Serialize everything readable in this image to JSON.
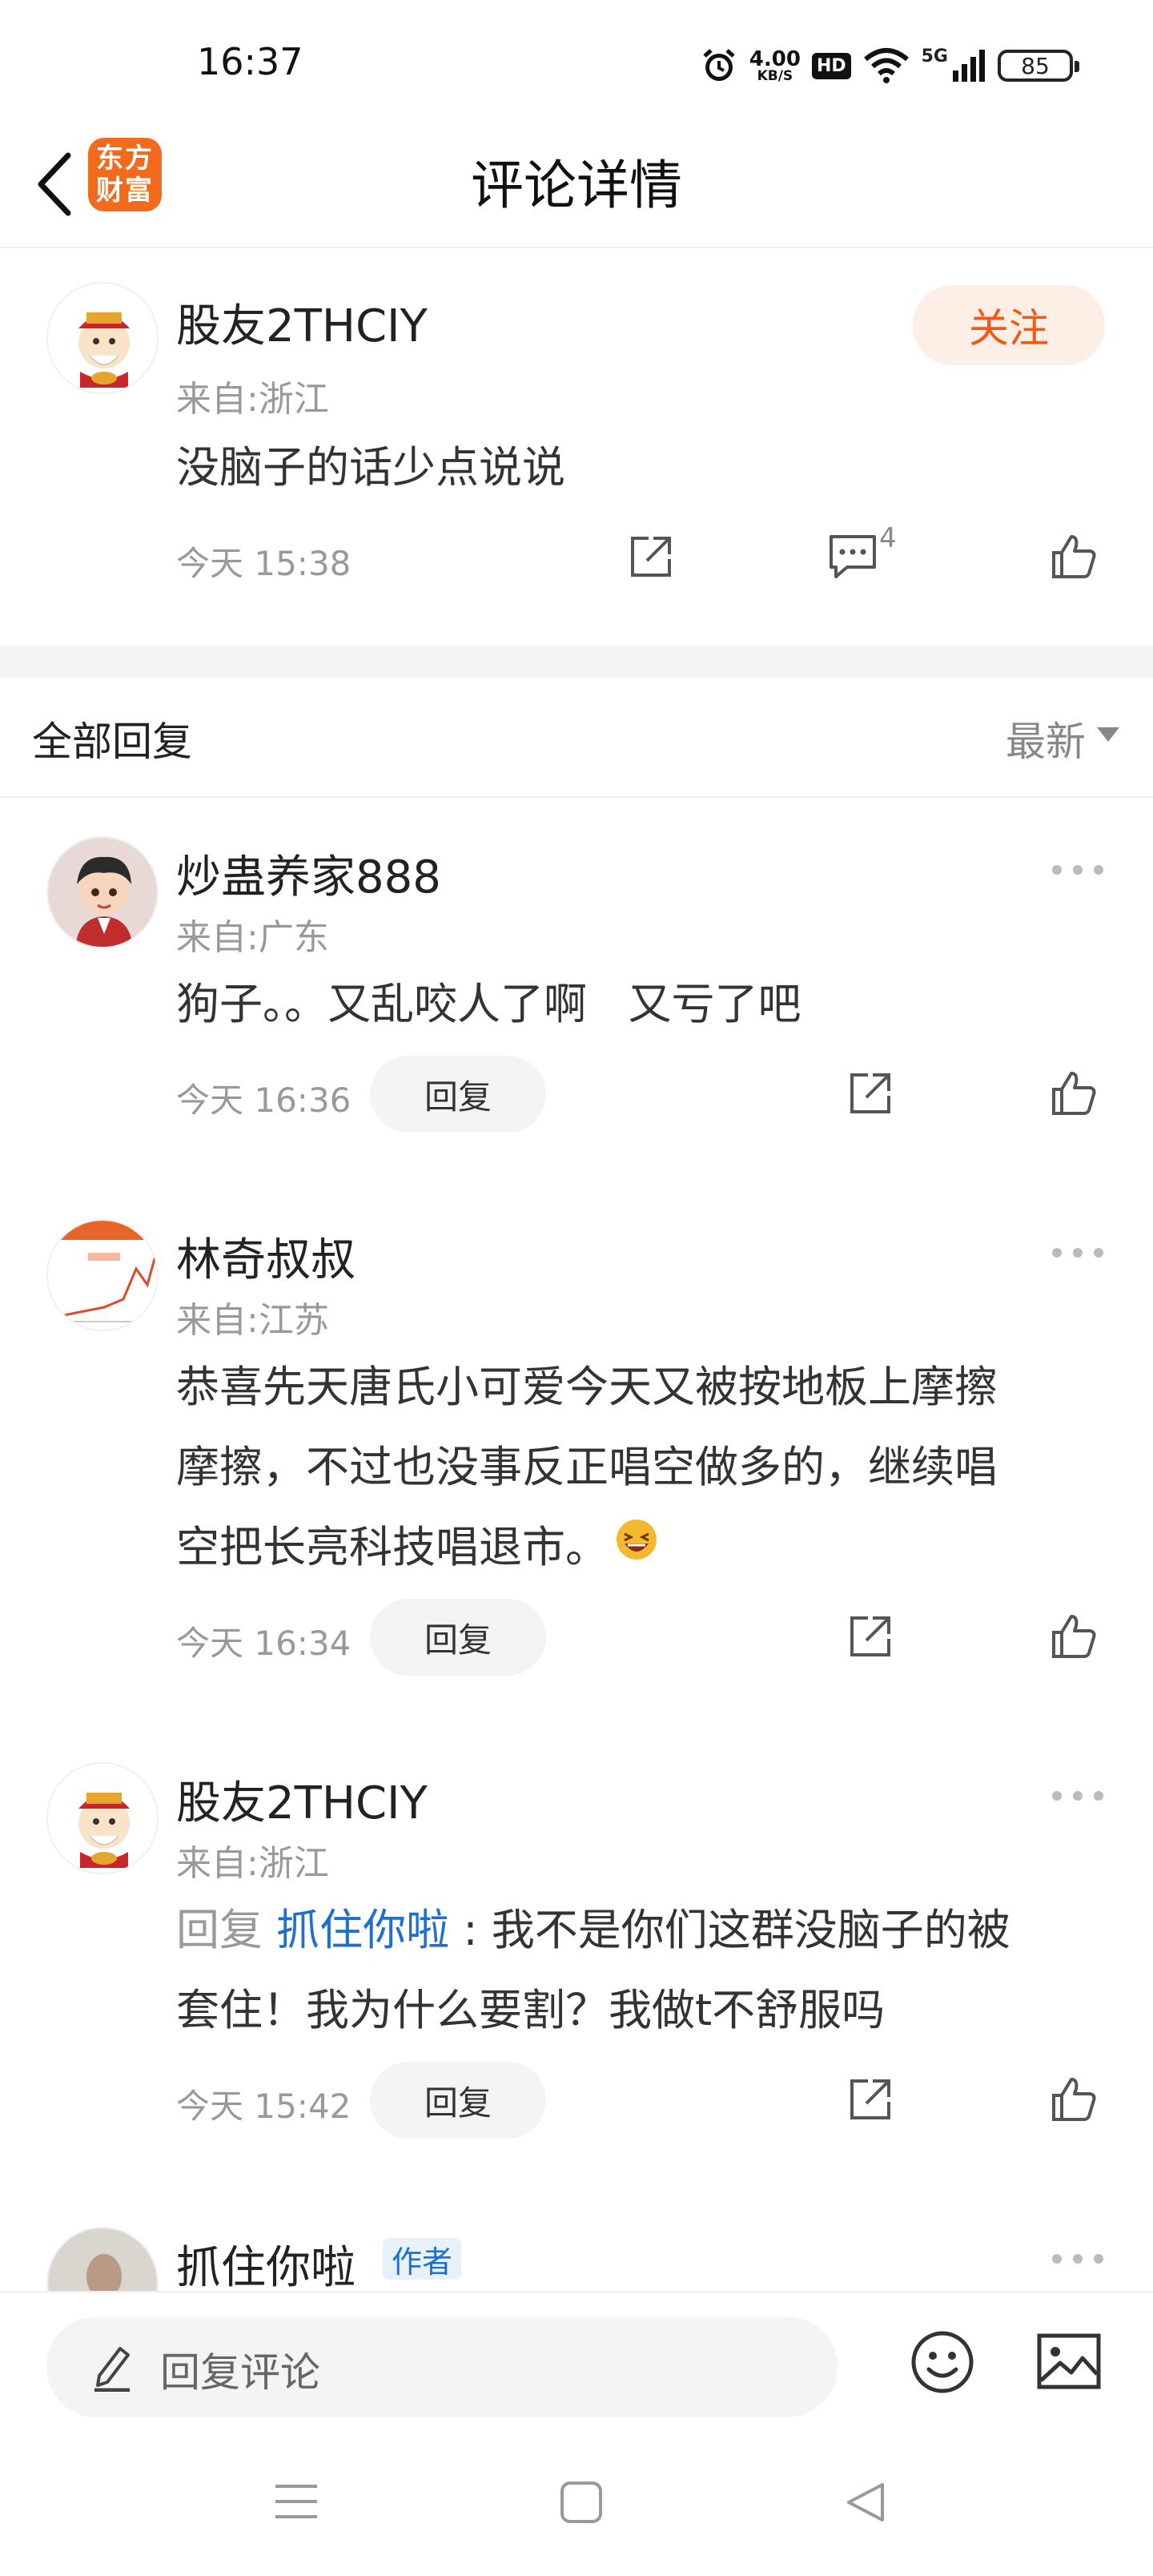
{
  "status_bar": {
    "time": "16:37",
    "net_speed": "4.00",
    "net_unit": "KB/S",
    "hd": "HD",
    "signal": "5G",
    "battery": "85"
  },
  "header": {
    "logo_line1": "东方",
    "logo_line2": "财富",
    "title": "评论详情"
  },
  "root_comment": {
    "username": "股友2THCIY",
    "region": "来自:浙江",
    "text": "没脑子的话少点说说",
    "time": "今天 15:38",
    "follow_label": "关注",
    "reply_count": "4"
  },
  "replies_section": {
    "title": "全部回复",
    "sort": "最新"
  },
  "replies": [
    {
      "username": "炒蛊养家888",
      "region": "来自:广东",
      "text": "狗子。。又乱咬人了啊   又亏了吧",
      "time": "今天 16:36",
      "reply_label": "回复"
    },
    {
      "username": "林奇叔叔",
      "region": "来自:江苏",
      "text_line1": "恭喜先天唐氏小可爱今天又被按地板上摩擦",
      "text_line2": "摩擦，不过也没事反正唱空做多的，继续唱",
      "text_line3": "空把长亮科技唱退市。",
      "time": "今天 16:34",
      "reply_label": "回复"
    },
    {
      "username": "股友2THCIY",
      "region": "来自:浙江",
      "reply_prefix": "回复 ",
      "reply_target": "抓住你啦",
      "text_line1": " : 我不是你们这群没脑子的被",
      "text_line2": "套住！我为什么要割？我做t不舒服吗",
      "time": "今天 15:42",
      "reply_label": "回复"
    },
    {
      "username": "抓住你啦",
      "author_tag": "作者"
    }
  ],
  "bottom_bar": {
    "input_placeholder": "回复评论"
  },
  "colors": {
    "accent": "#f05a16",
    "link": "#1f6fd1",
    "muted": "#999999"
  }
}
